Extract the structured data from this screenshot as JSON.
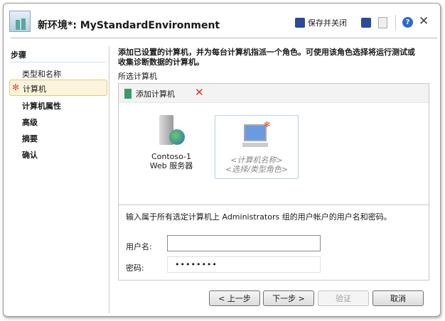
{
  "header": {
    "title": "新环境*: MyStandardEnvironment",
    "save_close": "保存并关闭"
  },
  "sidebar": {
    "heading": "步骤",
    "items": [
      {
        "label": "类型和名称"
      },
      {
        "label": "计算机"
      },
      {
        "label": "计算机属性"
      },
      {
        "label": "高级"
      },
      {
        "label": "摘要"
      },
      {
        "label": "确认"
      }
    ]
  },
  "main": {
    "instructions": "添加已设置的计算机，并为每台计算机指派一个角色。可使用该角色选择将运行测试或收集诊断数据的计算机。",
    "selected_label": "所选计算机",
    "add_machine": "添加计算机",
    "machines": [
      {
        "name": "Contoso-1",
        "role": "Web 服务器"
      },
      {
        "name": "<计算机名称>",
        "role": "<选择/类型角色>"
      }
    ],
    "credentials_text": "输入属于所有选定计算机上 Administrators 组的用户帐户的用户名和密码。",
    "username_label": "用户名:",
    "username_value": "",
    "password_label": "密码:",
    "password_value": "••••••••"
  },
  "buttons": {
    "back": "< 上一步",
    "next": "下一步 >",
    "verify": "验证",
    "cancel": "取消"
  }
}
